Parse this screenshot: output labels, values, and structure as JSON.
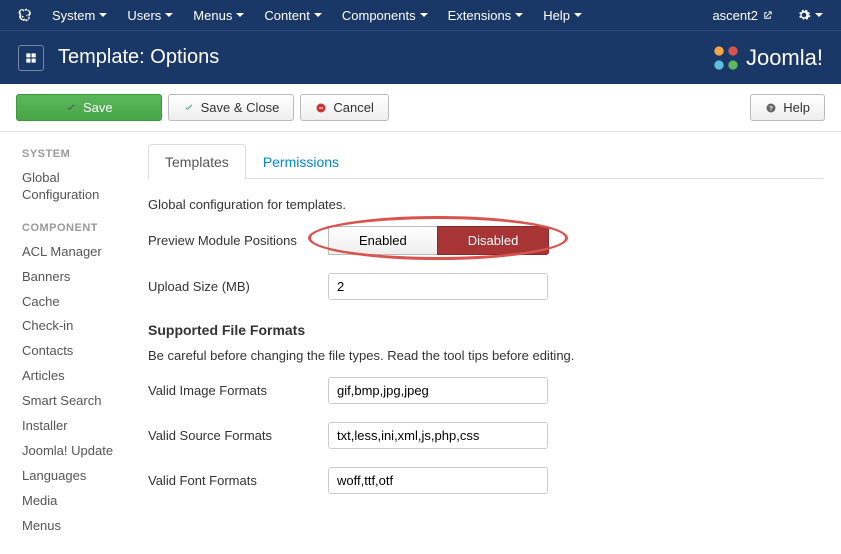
{
  "topnav": {
    "items": [
      "System",
      "Users",
      "Menus",
      "Content",
      "Components",
      "Extensions",
      "Help"
    ],
    "site_name": "ascent2"
  },
  "header": {
    "title": "Template: Options",
    "brand": "Joomla!"
  },
  "toolbar": {
    "save": "Save",
    "save_close": "Save & Close",
    "cancel": "Cancel",
    "help": "Help"
  },
  "sidebar": {
    "system_heading": "SYSTEM",
    "system_items": [
      "Global Configuration"
    ],
    "component_heading": "COMPONENT",
    "component_items": [
      "ACL Manager",
      "Banners",
      "Cache",
      "Check-in",
      "Contacts",
      "Articles",
      "Smart Search",
      "Installer",
      "Joomla! Update",
      "Languages",
      "Media",
      "Menus"
    ]
  },
  "tabs": {
    "templates": "Templates",
    "permissions": "Permissions"
  },
  "form": {
    "desc": "Global configuration for templates.",
    "preview_label": "Preview Module Positions",
    "enabled": "Enabled",
    "disabled": "Disabled",
    "upload_label": "Upload Size (MB)",
    "upload_value": "2",
    "formats_heading": "Supported File Formats",
    "formats_warning": "Be careful before changing the file types. Read the tool tips before editing.",
    "img_label": "Valid Image Formats",
    "img_value": "gif,bmp,jpg,jpeg",
    "src_label": "Valid Source Formats",
    "src_value": "txt,less,ini,xml,js,php,css",
    "font_label": "Valid Font Formats",
    "font_value": "woff,ttf,otf"
  }
}
